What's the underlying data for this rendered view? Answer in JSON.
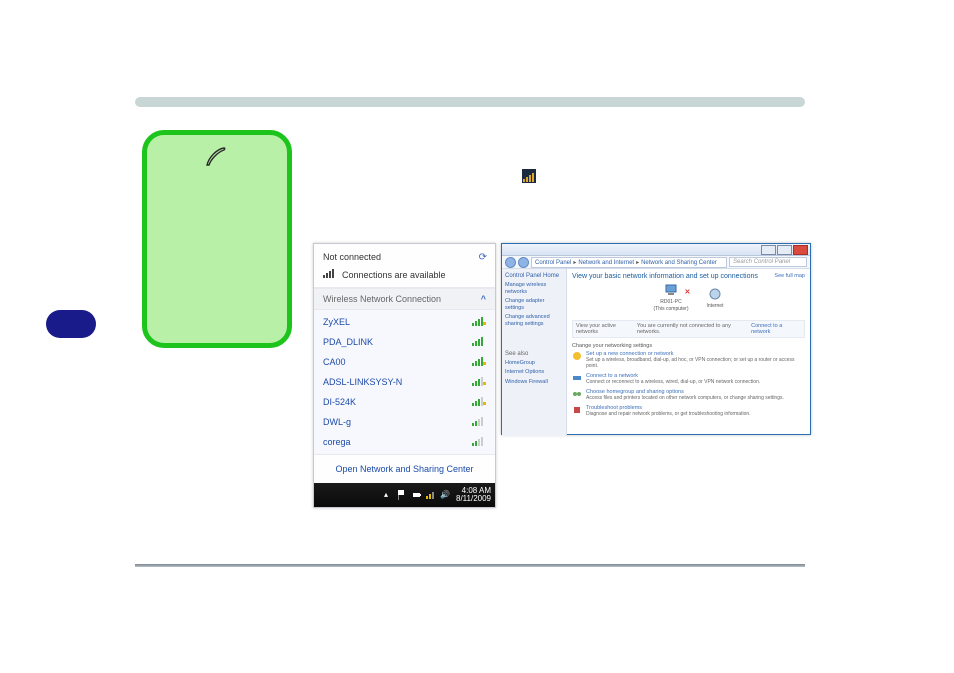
{
  "wifi": {
    "status": "Not connected",
    "available": "Connections are available",
    "section": "Wireless Network Connection",
    "items": [
      {
        "name": "ZyXEL",
        "secured": true,
        "bars": 4
      },
      {
        "name": "PDA_DLINK",
        "secured": false,
        "bars": 4
      },
      {
        "name": "CA00",
        "secured": true,
        "bars": 4
      },
      {
        "name": "ADSL-LINKSYSY-N",
        "secured": true,
        "bars": 3
      },
      {
        "name": "DI-524K",
        "secured": true,
        "bars": 3
      },
      {
        "name": "DWL-g",
        "secured": false,
        "bars": 2
      },
      {
        "name": "corega",
        "secured": false,
        "bars": 2
      }
    ],
    "open_center": "Open Network and Sharing Center",
    "time": "4:08 AM",
    "date": "8/11/2009"
  },
  "cp": {
    "crumbs": [
      "Control Panel",
      "Network and Internet",
      "Network and Sharing Center"
    ],
    "search_placeholder": "Search Control Panel",
    "side_heading": "Control Panel Home",
    "side_links": [
      "Manage wireless networks",
      "Change adapter settings",
      "Change advanced sharing settings"
    ],
    "see_also": "See also",
    "see_also_links": [
      "HomeGroup",
      "Internet Options",
      "Windows Firewall"
    ],
    "title": "View your basic network information and set up connections",
    "see_full_map": "See full map",
    "node_this": "RD01-PC",
    "node_this_sub": "(This computer)",
    "node_internet": "Internet",
    "active_label": "View your active networks",
    "active_msg": "You are currently not connected to any networks.",
    "connect_link": "Connect to a network",
    "settings_label": "Change your networking settings",
    "links": [
      {
        "t": "Set up a new connection or network",
        "d": "Set up a wireless, broadband, dial-up, ad hoc, or VPN connection; or set up a router or access point."
      },
      {
        "t": "Connect to a network",
        "d": "Connect or reconnect to a wireless, wired, dial-up, or VPN network connection."
      },
      {
        "t": "Choose homegroup and sharing options",
        "d": "Access files and printers located on other network computers, or change sharing settings."
      },
      {
        "t": "Troubleshoot problems",
        "d": "Diagnose and repair network problems, or get troubleshooting information."
      }
    ]
  }
}
